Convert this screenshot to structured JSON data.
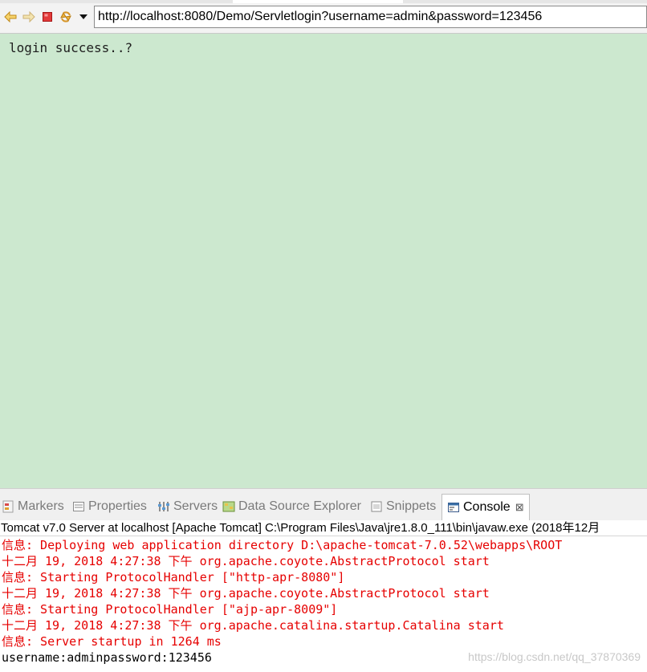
{
  "browser": {
    "url": "http://localhost:8080/Demo/Servletlogin?username=admin&password=123456",
    "icons": [
      "back-arrow-icon",
      "forward-arrow-icon",
      "stop-icon",
      "refresh-icon",
      "dropdown-arrow-icon"
    ]
  },
  "page": {
    "message": "login success..?"
  },
  "views": {
    "tabs": [
      {
        "label": "Markers",
        "icon": "markers-icon"
      },
      {
        "label": "Properties",
        "icon": "properties-icon"
      },
      {
        "label": "Servers",
        "icon": "servers-icon"
      },
      {
        "label": "Data Source Explorer",
        "icon": "data-source-icon"
      },
      {
        "label": "Snippets",
        "icon": "snippets-icon"
      },
      {
        "label": "Console",
        "icon": "console-icon",
        "active": true
      }
    ],
    "close_glyph": "⊠"
  },
  "console": {
    "header": "Tomcat v7.0 Server at localhost [Apache Tomcat] C:\\Program Files\\Java\\jre1.8.0_111\\bin\\javaw.exe (2018年12月",
    "lines": [
      {
        "text": "信息: Deploying web application directory D:\\apache-tomcat-7.0.52\\webapps\\ROOT",
        "color": "#e60000"
      },
      {
        "text": "十二月 19, 2018 4:27:38 下午 org.apache.coyote.AbstractProtocol start",
        "color": "#e60000"
      },
      {
        "text": "信息: Starting ProtocolHandler [\"http-apr-8080\"]",
        "color": "#e60000"
      },
      {
        "text": "十二月 19, 2018 4:27:38 下午 org.apache.coyote.AbstractProtocol start",
        "color": "#e60000"
      },
      {
        "text": "信息: Starting ProtocolHandler [\"ajp-apr-8009\"]",
        "color": "#e60000"
      },
      {
        "text": "十二月 19, 2018 4:27:38 下午 org.apache.catalina.startup.Catalina start",
        "color": "#e60000"
      },
      {
        "text": "信息: Server startup in 1264 ms",
        "color": "#e60000"
      },
      {
        "text": "username:adminpassword:123456",
        "color": "#000000"
      }
    ]
  },
  "watermark": "https://blog.csdn.net/qq_37870369",
  "colors": {
    "page_background": "#cce8cf",
    "console_error": "#e60000",
    "console_output": "#000000"
  }
}
